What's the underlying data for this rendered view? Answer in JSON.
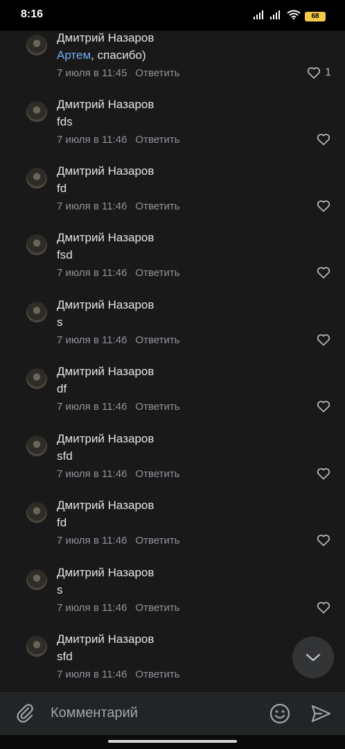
{
  "status_bar": {
    "time": "8:16",
    "battery": "68",
    "icons": [
      "signal-icon",
      "signal-icon",
      "wifi-icon",
      "battery-icon"
    ]
  },
  "comments": [
    {
      "author": "Дмитрий Назаров",
      "mention": "Артем",
      "text": ", спасибо)",
      "date": "7 июля в 11:45",
      "reply": "Ответить",
      "likes": "1"
    },
    {
      "author": "Дмитрий Назаров",
      "mention": "",
      "text": "fds",
      "date": "7 июля в 11:46",
      "reply": "Ответить",
      "likes": ""
    },
    {
      "author": "Дмитрий Назаров",
      "mention": "",
      "text": "fd",
      "date": "7 июля в 11:46",
      "reply": "Ответить",
      "likes": ""
    },
    {
      "author": "Дмитрий Назаров",
      "mention": "",
      "text": "fsd",
      "date": "7 июля в 11:46",
      "reply": "Ответить",
      "likes": ""
    },
    {
      "author": "Дмитрий Назаров",
      "mention": "",
      "text": "s",
      "date": "7 июля в 11:46",
      "reply": "Ответить",
      "likes": ""
    },
    {
      "author": "Дмитрий Назаров",
      "mention": "",
      "text": "df",
      "date": "7 июля в 11:46",
      "reply": "Ответить",
      "likes": ""
    },
    {
      "author": "Дмитрий Назаров",
      "mention": "",
      "text": "sfd",
      "date": "7 июля в 11:46",
      "reply": "Ответить",
      "likes": ""
    },
    {
      "author": "Дмитрий Назаров",
      "mention": "",
      "text": "fd",
      "date": "7 июля в 11:46",
      "reply": "Ответить",
      "likes": ""
    },
    {
      "author": "Дмитрий Назаров",
      "mention": "",
      "text": "s",
      "date": "7 июля в 11:46",
      "reply": "Ответить",
      "likes": ""
    },
    {
      "author": "Дмитрий Назаров",
      "mention": "",
      "text": "sfd",
      "date": "7 июля в 11:46",
      "reply": "Ответить",
      "likes": ""
    }
  ],
  "composer": {
    "placeholder": "Комментарий"
  },
  "colors": {
    "background": "#19191a",
    "mention": "#71aaeb",
    "meta": "#8f9399",
    "composer": "#232425"
  }
}
